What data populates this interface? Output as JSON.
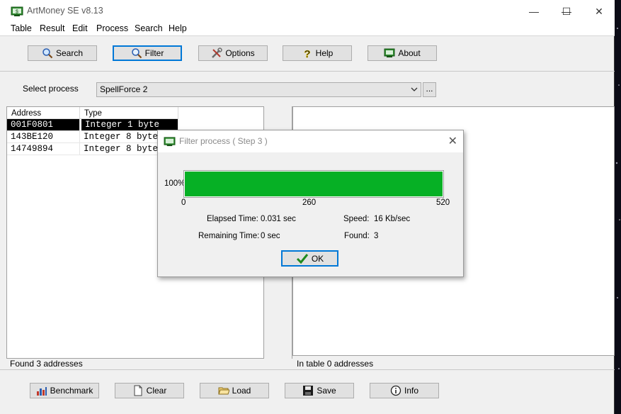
{
  "window": {
    "title": "ArtMoney SE v8.13",
    "controls": {
      "minimize": "—",
      "maximize": "☐",
      "close": "✕"
    }
  },
  "menu": [
    "Table",
    "Result",
    "Edit",
    "Process",
    "Search",
    "Help"
  ],
  "toolbar": {
    "search": "Search",
    "filter": "Filter",
    "options": "Options",
    "help": "Help",
    "about": "About"
  },
  "process": {
    "label": "Select process",
    "selected": "SpellForce 2",
    "browse": "..."
  },
  "left_table": {
    "columns": [
      "Address",
      "Type"
    ],
    "rows": [
      {
        "address": "001F0801",
        "type": "Integer 1 byte"
      },
      {
        "address": "143BE120",
        "type": "Integer 8 byte"
      },
      {
        "address": "14749894",
        "type": "Integer 8 byte"
      }
    ],
    "status": "Found 3 addresses"
  },
  "right_table": {
    "status": "In table 0 addresses"
  },
  "bottom": {
    "benchmark": "Benchmark",
    "clear": "Clear",
    "load": "Load",
    "save": "Save",
    "info": "Info"
  },
  "dialog": {
    "title": "Filter process ( Step 3 )",
    "close": "✕",
    "percent_label": "100%",
    "progress": 1.0,
    "scale": [
      "0",
      "260",
      "520"
    ],
    "elapsed_label": "Elapsed Time:",
    "elapsed_value": "0.031 sec",
    "remaining_label": "Remaining Time:",
    "remaining_value": "0 sec",
    "speed_label": "Speed:",
    "speed_value": "16 Kb/sec",
    "found_label": "Found:",
    "found_value": "3",
    "ok": "OK"
  },
  "colors": {
    "progress": "#06b025",
    "focus_border": "#0078d7",
    "selection": "#000000"
  }
}
